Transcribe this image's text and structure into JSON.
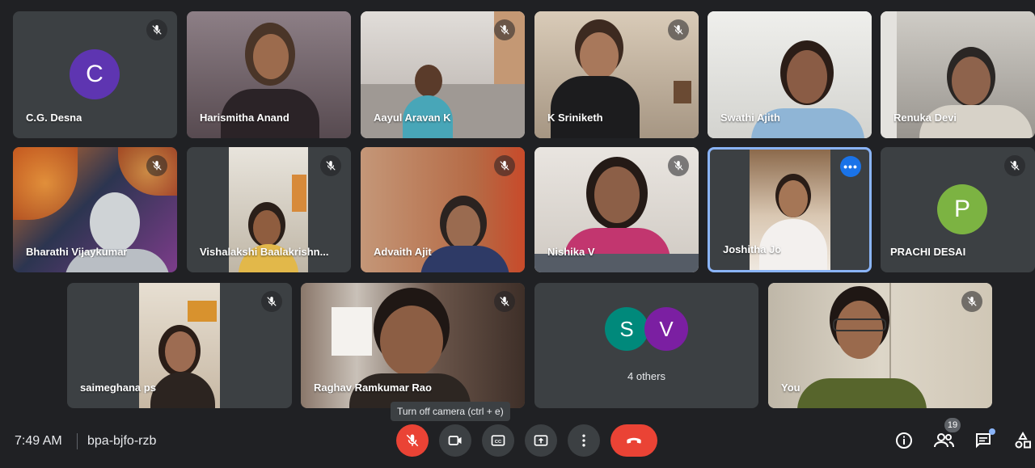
{
  "participants": [
    {
      "name": "C.G. Desna",
      "avatar_letter": "C",
      "avatar_color": "#5e35b1"
    },
    {
      "name": "Harismitha Anand"
    },
    {
      "name": "Aayul Aravan K"
    },
    {
      "name": "K Sriniketh"
    },
    {
      "name": "Swathi Ajith"
    },
    {
      "name": "Renuka Devi"
    },
    {
      "name": "Bharathi Vijaykumar"
    },
    {
      "name": "Vishalakshi Baalakrishn..."
    },
    {
      "name": "Advaith Ajit"
    },
    {
      "name": "Nishika V"
    },
    {
      "name": "Joshitha Jo"
    },
    {
      "name": "PRACHI DESAI",
      "avatar_letter": "P",
      "avatar_color": "#7cb342"
    },
    {
      "name": "saimeghana ps"
    },
    {
      "name": "Raghav Ramkumar Rao"
    },
    {
      "name": "You"
    }
  ],
  "others": {
    "label": "4 others",
    "avatars": [
      {
        "letter": "S",
        "color": "#00897b"
      },
      {
        "letter": "V",
        "color": "#7b1fa2"
      }
    ]
  },
  "meeting": {
    "time": "7:49 AM",
    "code": "bpa-bjfo-rzb"
  },
  "tooltip": "Turn off camera (ctrl + e)",
  "participant_count": "19",
  "colors": {
    "background": "#202124",
    "tile": "#3c4043",
    "end_call": "#ea4335",
    "active_border": "#8ab4f8",
    "accent": "#1a73e8"
  }
}
